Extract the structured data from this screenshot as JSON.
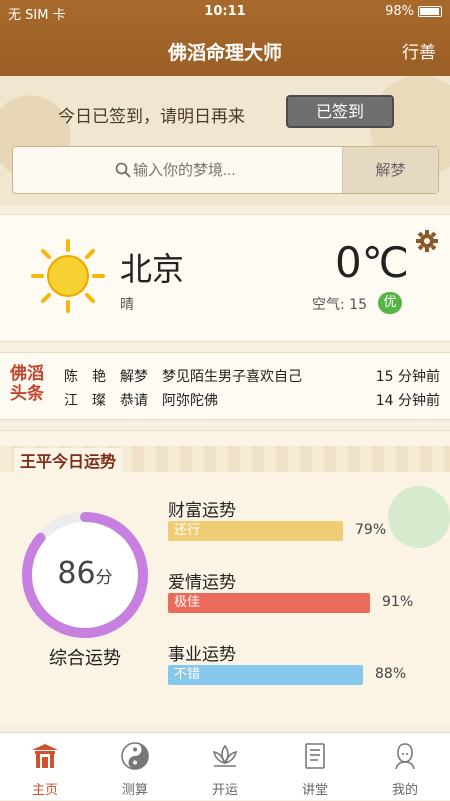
{
  "status": {
    "carrier": "无 SIM 卡",
    "time": "10:11",
    "battery": "98%"
  },
  "nav": {
    "title": "佛滔命理大师",
    "right": "行善"
  },
  "signin": {
    "message": "今日已签到，请明日再来",
    "button": "已签到"
  },
  "search": {
    "placeholder": "输入你的梦境...",
    "button": "解梦"
  },
  "weather": {
    "city": "北京",
    "condition": "晴",
    "temp": "0℃",
    "air_label": "空气: 15",
    "air_quality": "优"
  },
  "news": {
    "logo": "佛滔头条",
    "items": [
      {
        "title": "陈　艳　解梦　梦见陌生男子喜欢自己",
        "time": "15 分钟前"
      },
      {
        "title": "江　璨　恭请　阿弥陀佛",
        "time": "14 分钟前"
      }
    ]
  },
  "fortune": {
    "title": "王平今日运势",
    "score": "86",
    "score_unit": "分",
    "score_value": 0.86,
    "score_label": "综合运势",
    "items": [
      {
        "name": "财富运势",
        "level": "还行",
        "percent": "79%",
        "value": 0.79,
        "color": "#f0cd74"
      },
      {
        "name": "爱情运势",
        "level": "极佳",
        "percent": "91%",
        "value": 0.91,
        "color": "#ea6a5c"
      },
      {
        "name": "事业运势",
        "level": "不错",
        "percent": "88%",
        "value": 0.88,
        "color": "#86c7ec"
      }
    ]
  },
  "tabs": [
    {
      "label": "主页",
      "icon": "temple-icon",
      "active": true
    },
    {
      "label": "测算",
      "icon": "yin-yang-icon",
      "active": false
    },
    {
      "label": "开运",
      "icon": "lotus-icon",
      "active": false
    },
    {
      "label": "讲堂",
      "icon": "book-icon",
      "active": false
    },
    {
      "label": "我的",
      "icon": "buddha-icon",
      "active": false
    }
  ]
}
